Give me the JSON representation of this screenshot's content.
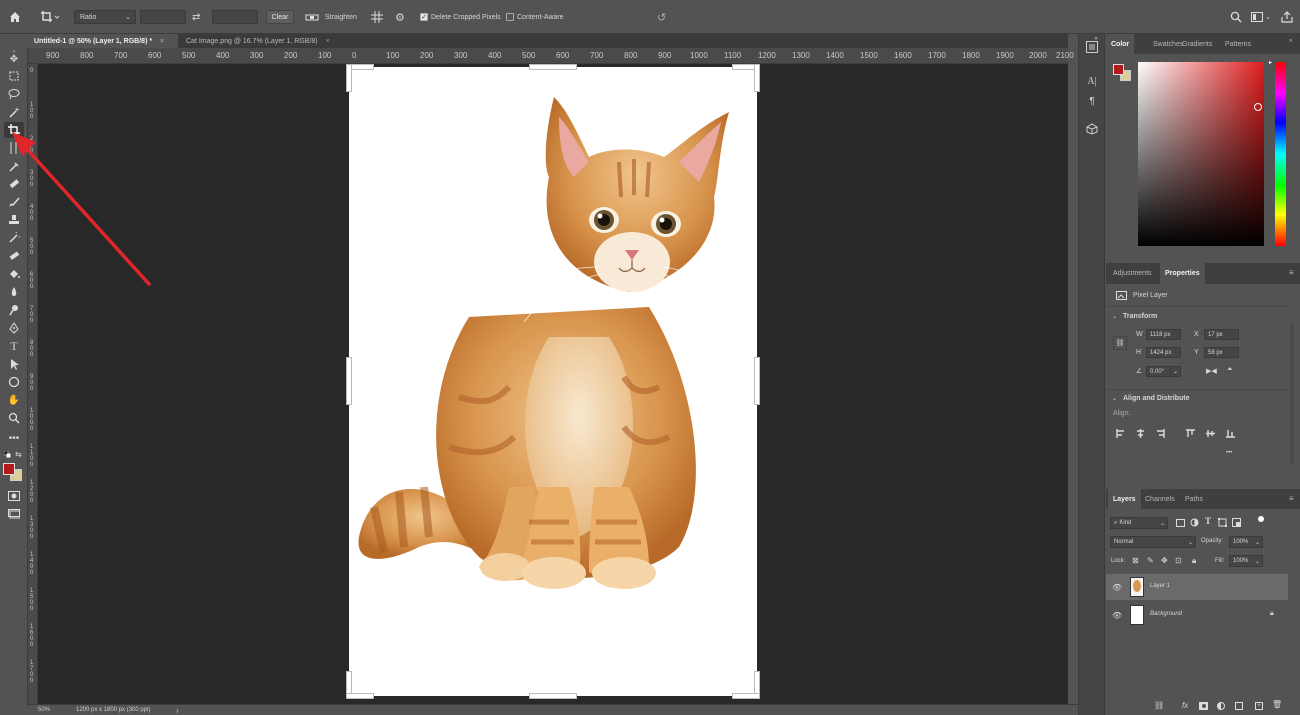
{
  "options_bar": {
    "ratio_value": "Ratio",
    "clear_label": "Clear",
    "straighten_label": "Straighten",
    "delete_cropped_label": "Delete Cropped Pixels",
    "delete_cropped_checked": true,
    "content_aware_label": "Content-Aware",
    "content_aware_checked": false
  },
  "tabs": [
    {
      "label": "Untitled-1 @ 50% (Layer 1, RGB/8) *",
      "close": "×"
    },
    {
      "label": "Cat Image.png @ 16.7% (Layer 1, RGB/8)",
      "close": "×"
    }
  ],
  "ruler_top": [
    "900",
    "800",
    "700",
    "600",
    "500",
    "400",
    "300",
    "200",
    "100",
    "0",
    "100",
    "200",
    "300",
    "400",
    "500",
    "600",
    "700",
    "800",
    "900",
    "1000",
    "1100",
    "1200",
    "1300",
    "1400",
    "1500",
    "1600",
    "1700",
    "1800",
    "1900",
    "2000",
    "2100"
  ],
  "ruler_left": [
    "0",
    "1 0 0",
    "2 0 0",
    "3 0 0",
    "4 0 0",
    "5 0 0",
    "6 0 0",
    "7 0 0",
    "8 0 0",
    "9 0 0",
    "1 0 0 0",
    "1 1 0 0",
    "1 2 0 0",
    "1 3 0 0",
    "1 4 0 0",
    "1 5 0 0",
    "1 6 0 0",
    "1 7 0 0",
    "1 8 0 0"
  ],
  "status": {
    "zoom": "50%",
    "doc_info": "1200 px x 1800 px (300 ppi)",
    "arrow": "›"
  },
  "color_panel": {
    "tabs": [
      "Color",
      "Swatches",
      "Gradients",
      "Patterns"
    ],
    "foreground": "#b31b1b",
    "background": "#d9cf9a"
  },
  "properties_panel": {
    "tabs": [
      "Adjustments",
      "Properties"
    ],
    "layer_type": "Pixel Layer",
    "transform_label": "Transform",
    "w_label": "W",
    "w_value": "1118 px",
    "h_label": "H",
    "h_value": "1424 px",
    "x_label": "X",
    "x_value": "17 px",
    "y_label": "Y",
    "y_value": "58 px",
    "angle_value": "0.00°",
    "align_label": "Align and Distribute",
    "align_sub": "Align:",
    "more": "•••"
  },
  "layers_panel": {
    "tabs": [
      "Layers",
      "Channels",
      "Paths"
    ],
    "kind_value": "Kind",
    "blend_mode": "Normal",
    "opacity_label": "Opacity:",
    "opacity_value": "100%",
    "lock_label": "Lock:",
    "fill_label": "Fill:",
    "fill_value": "100%",
    "layers": [
      {
        "name": "Layer 1"
      },
      {
        "name": "Background"
      }
    ]
  },
  "colors": {
    "accent_arrow": "#e0262a",
    "canvas_bg": "#282828",
    "ui_bg": "#535353"
  }
}
